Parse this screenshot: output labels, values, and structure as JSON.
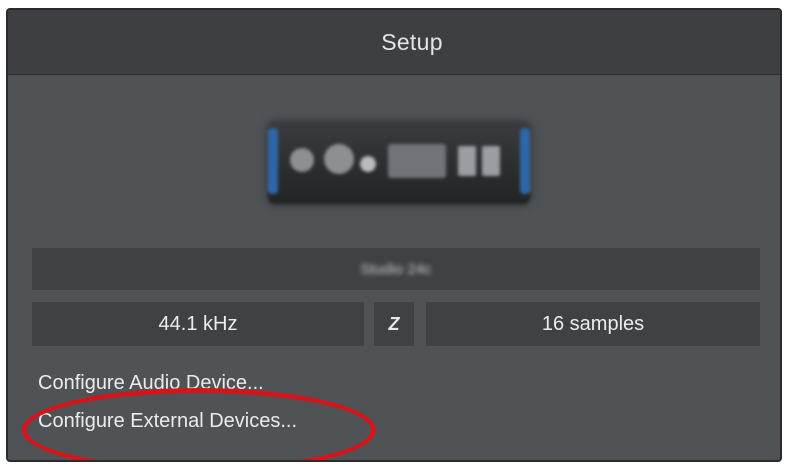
{
  "window": {
    "title": "Setup"
  },
  "device": {
    "image_icon": "audio-interface-device-image",
    "name": "Studio 24c"
  },
  "audio_settings": {
    "sample_rate": "44.1 kHz",
    "link_icon": "z-link-icon",
    "link_glyph": "Z",
    "buffer_size": "16 samples"
  },
  "menu": {
    "configure_audio_label": "Configure Audio Device...",
    "configure_external_label": "Configure External Devices..."
  },
  "annotation": {
    "highlight_color": "#d5151a"
  },
  "colors": {
    "panel_bg": "#505356",
    "header_bg": "#3d3f42",
    "field_bg": "#3f4144",
    "device_accent": "#2d67a8"
  }
}
